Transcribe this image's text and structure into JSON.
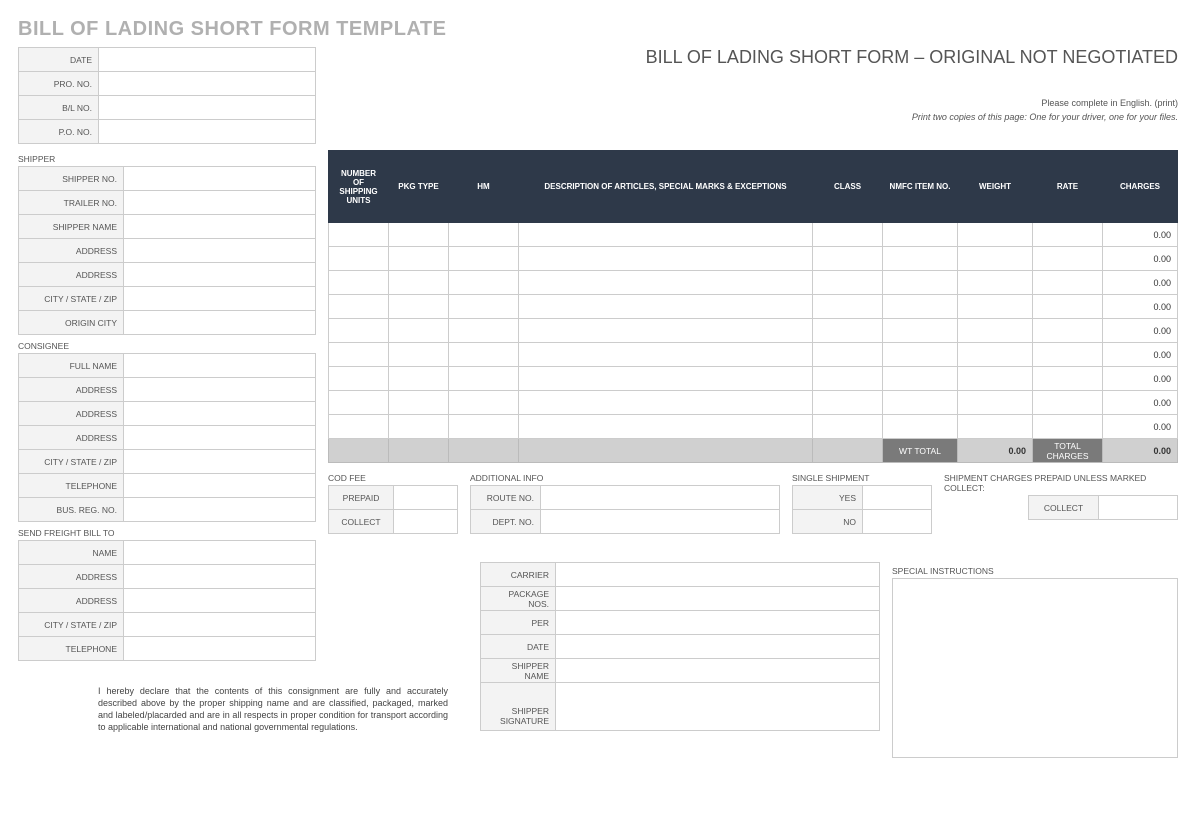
{
  "title": "BILL OF LADING SHORT FORM TEMPLATE",
  "subtitle": "BILL OF LADING SHORT FORM – ORIGINAL NOT NEGOTIATED",
  "instruction1": "Please complete in English. (print)",
  "instruction2": "Print two copies of this page: One for your driver, one for your files.",
  "header_fields": {
    "date_label": "DATE",
    "date_value": "",
    "pro_label": "PRO. NO.",
    "pro_value": "",
    "bl_label": "B/L NO.",
    "bl_value": "",
    "po_label": "P.O. NO.",
    "po_value": ""
  },
  "shipper": {
    "section": "SHIPPER",
    "no_label": "SHIPPER NO.",
    "no_value": "",
    "trailer_label": "TRAILER  NO.",
    "trailer_value": "",
    "name_label": "SHIPPER NAME",
    "name_value": "",
    "addr1_label": "ADDRESS",
    "addr1_value": "",
    "addr2_label": "ADDRESS",
    "addr2_value": "",
    "csz_label": "CITY / STATE / ZIP",
    "csz_value": "",
    "origin_label": "ORIGIN CITY",
    "origin_value": ""
  },
  "consignee": {
    "section": "CONSIGNEE",
    "name_label": "FULL NAME",
    "name_value": "",
    "addr1_label": "ADDRESS",
    "addr1_value": "",
    "addr2_label": "ADDRESS",
    "addr2_value": "",
    "addr3_label": "ADDRESS",
    "addr3_value": "",
    "csz_label": "CITY / STATE / ZIP",
    "csz_value": "",
    "tel_label": "TELEPHONE",
    "tel_value": "",
    "bus_label": "BUS. REG. NO.",
    "bus_value": ""
  },
  "freight_bill": {
    "section": "SEND FREIGHT BILL TO",
    "name_label": "NAME",
    "name_value": "",
    "addr1_label": "ADDRESS",
    "addr1_value": "",
    "addr2_label": "ADDRESS",
    "addr2_value": "",
    "csz_label": "CITY / STATE / ZIP",
    "csz_value": "",
    "tel_label": "TELEPHONE",
    "tel_value": ""
  },
  "items_table": {
    "headers": {
      "units": "NUMBER OF SHIPPING UNITS",
      "pkg": "PKG TYPE",
      "hm": "HM",
      "desc": "DESCRIPTION OF ARTICLES, SPECIAL MARKS & EXCEPTIONS",
      "class": "CLASS",
      "nmfc": "NMFC ITEM NO.",
      "weight": "WEIGHT",
      "rate": "RATE",
      "charges": "CHARGES"
    },
    "rows": [
      {
        "charges": "0.00"
      },
      {
        "charges": "0.00"
      },
      {
        "charges": "0.00"
      },
      {
        "charges": "0.00"
      },
      {
        "charges": "0.00"
      },
      {
        "charges": "0.00"
      },
      {
        "charges": "0.00"
      },
      {
        "charges": "0.00"
      },
      {
        "charges": "0.00"
      }
    ],
    "totals": {
      "wt_label": "WT TOTAL",
      "wt_value": "0.00",
      "charges_label": "TOTAL CHARGES",
      "charges_value": "0.00"
    }
  },
  "cod": {
    "section": "COD FEE",
    "prepaid_label": "PREPAID",
    "prepaid_value": "",
    "collect_label": "COLLECT",
    "collect_value": ""
  },
  "addl": {
    "section": "ADDITIONAL INFO",
    "route_label": "ROUTE NO.",
    "route_value": "",
    "dept_label": "DEPT. NO.",
    "dept_value": ""
  },
  "single_shipment": {
    "section": "SINGLE SHIPMENT",
    "yes_label": "YES",
    "yes_value": "",
    "no_label": "NO",
    "no_value": ""
  },
  "ship_charges": {
    "section": "SHIPMENT CHARGES PREPAID UNLESS MARKED COLLECT:",
    "collect_label": "COLLECT",
    "collect_value": ""
  },
  "carrier": {
    "carrier_label": "CARRIER",
    "carrier_value": "",
    "pkg_label": "PACKAGE NOS.",
    "pkg_value": "",
    "per_label": "PER",
    "per_value": "",
    "date_label": "DATE",
    "date_value": "",
    "name_label": "SHIPPER NAME",
    "name_value": "",
    "sig_label": "SHIPPER SIGNATURE",
    "sig_value": ""
  },
  "special": {
    "section": "SPECIAL INSTRUCTIONS",
    "value": ""
  },
  "declaration": "I hereby declare that the contents of this consignment are fully and accurately described above by the proper shipping name and are classified, packaged, marked and labeled/placarded and are in all respects in proper condition for transport according to applicable international and national governmental regulations."
}
